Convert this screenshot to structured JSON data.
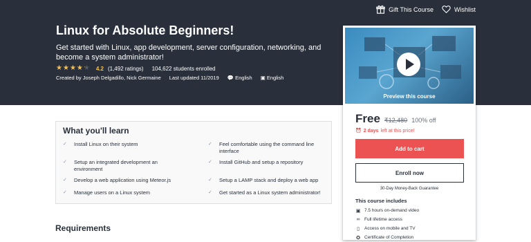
{
  "topbar": {
    "gift_label": "Gift This Course",
    "wishlist_label": "Wishlist"
  },
  "course": {
    "title": "Linux for Absolute Beginners!",
    "subtitle": "Get started with Linux, app development, server configuration, networking, and become a system administrator!",
    "rating": "4.2",
    "ratings_count": "(1,492 ratings)",
    "students": "104,622 students enrolled",
    "stars_filled": 4.2,
    "created_by": "Created by Joseph Delgadillo, Nick Germaine",
    "last_updated": "Last updated 11/2019",
    "language": "English",
    "captions": "English"
  },
  "card": {
    "preview_label": "Preview this course",
    "price": "Free",
    "original_price": "₹12,480",
    "discount": "100% off",
    "urgency_bold": "2 days",
    "urgency_rest": "left at this price!",
    "add_to_cart": "Add to cart",
    "enroll_now": "Enroll now",
    "guarantee": "30-Day Money-Back Guarantee",
    "includes_title": "This course includes",
    "includes": [
      {
        "icon": "video-icon",
        "label": "7.5 hours on-demand video"
      },
      {
        "icon": "infinity-icon",
        "label": "Full lifetime access"
      },
      {
        "icon": "mobile-icon",
        "label": "Access on mobile and TV"
      },
      {
        "icon": "certificate-icon",
        "label": "Certificate of Completion"
      }
    ]
  },
  "learn": {
    "title": "What you'll learn",
    "items": [
      "Install Linux on their system",
      "Feel comfortable using the command line interface",
      "Setup an integrated development an environment",
      "Install GitHub and setup a repository",
      "Develop a web application using Meteor.js",
      "Setup a LAMP stack and deploy a web app",
      "Manage users on a Linux system",
      "Get started as a Linux system administrator!"
    ]
  },
  "requirements": {
    "title": "Requirements"
  },
  "colors": {
    "hero_bg": "#29303b",
    "accent_red": "#ec5252",
    "star": "#f4c150"
  }
}
